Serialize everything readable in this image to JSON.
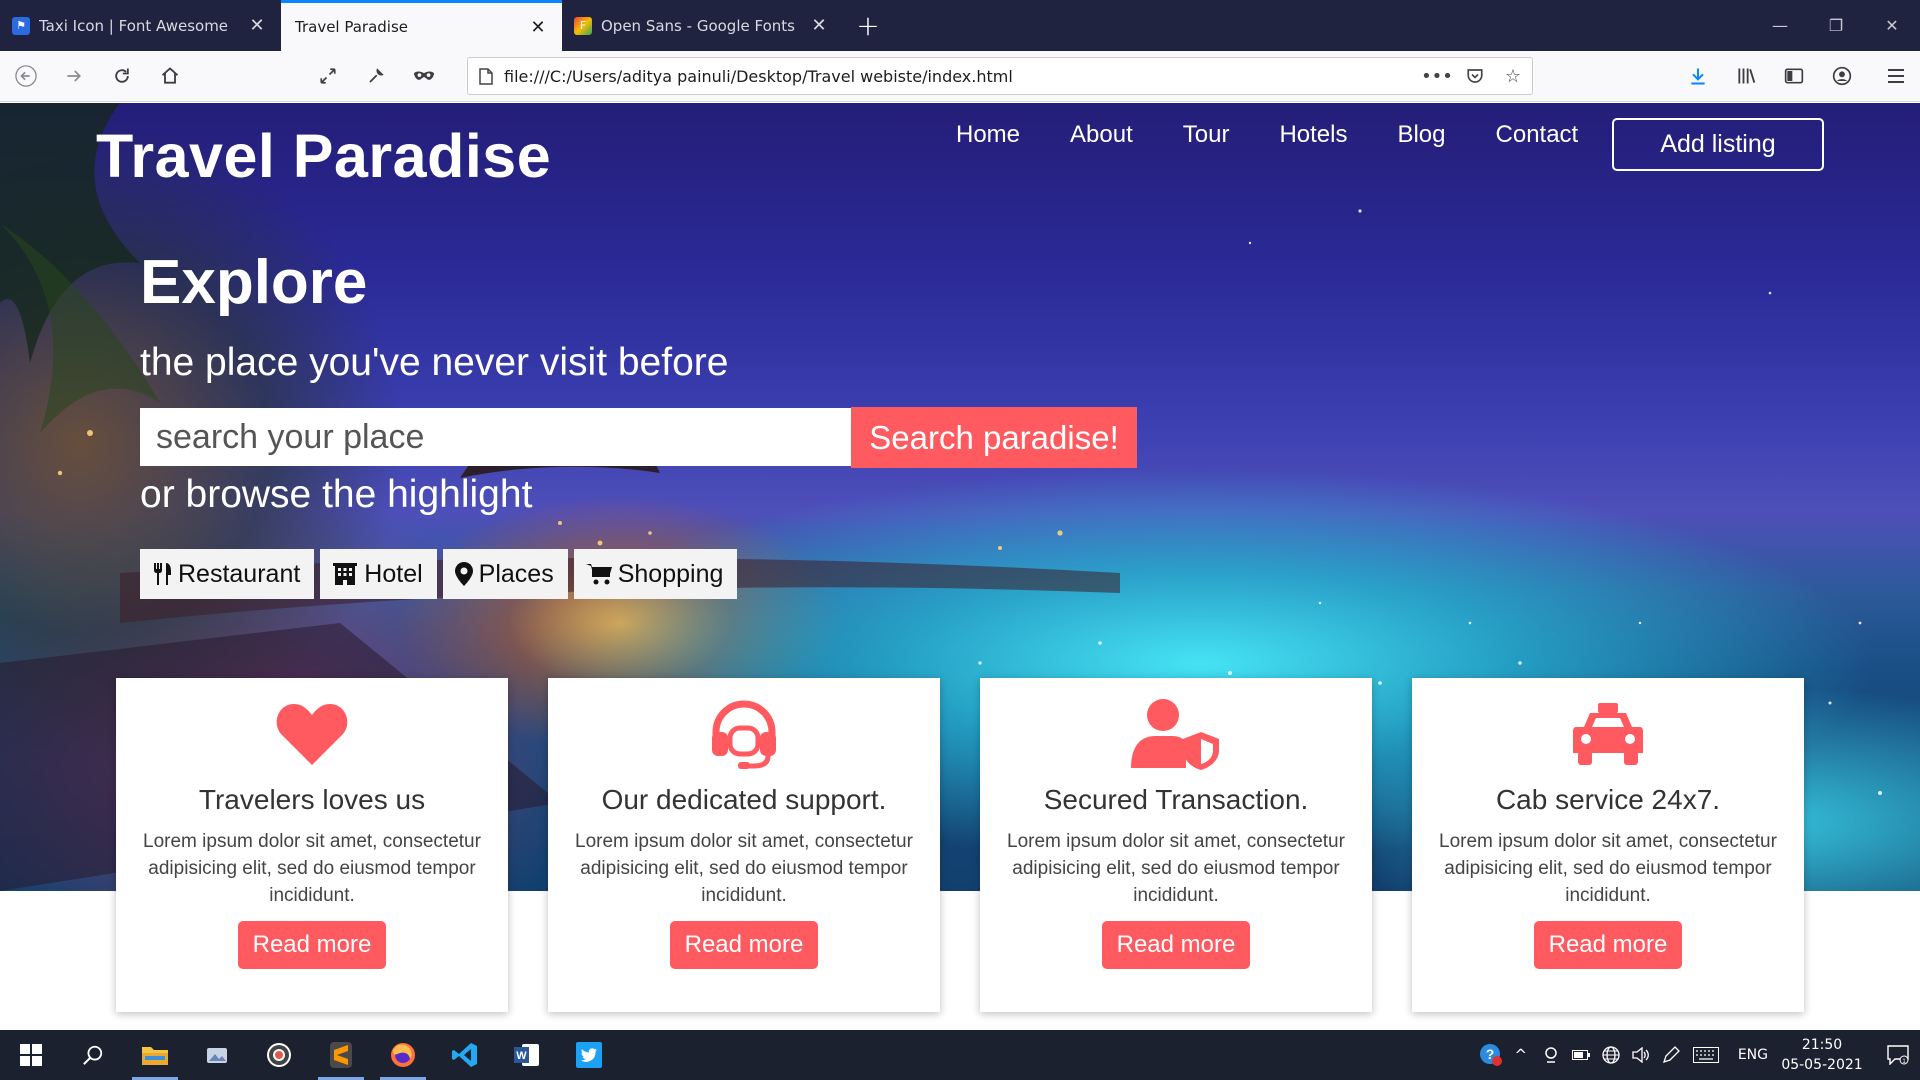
{
  "browser": {
    "tabs": [
      {
        "title": "Taxi Icon | Font Awesome",
        "active": false,
        "favicon_color": "#2a6be0"
      },
      {
        "title": "Travel Paradise",
        "active": true,
        "favicon_color": ""
      },
      {
        "title": "Open Sans - Google Fonts",
        "active": false,
        "favicon_color": "#ea4335"
      }
    ],
    "url": "file:///C:/Users/aditya painuli/Desktop/Travel webiste/index.html"
  },
  "page": {
    "brand": "Travel Paradise",
    "nav": [
      "Home",
      "About",
      "Tour",
      "Hotels",
      "Blog",
      "Contact"
    ],
    "add_listing": "Add listing",
    "hero": {
      "title": "Explore",
      "subtitle": "the place you've never visit before",
      "search_placeholder": "search your place",
      "search_button": "Search paradise!",
      "browse_text": "or browse the highlight"
    },
    "categories": [
      {
        "label": "Restaurant",
        "icon": "utensils-icon"
      },
      {
        "label": "Hotel",
        "icon": "hotel-icon"
      },
      {
        "label": "Places",
        "icon": "map-marker-icon"
      },
      {
        "label": "Shopping",
        "icon": "shopping-cart-icon"
      }
    ],
    "cards": [
      {
        "title": "Travelers loves us",
        "text": "Lorem ipsum dolor sit amet, consectetur adipisicing elit, sed do eiusmod tempor incididunt.",
        "button": "Read more",
        "icon": "heart-icon"
      },
      {
        "title": "Our dedicated support.",
        "text": "Lorem ipsum dolor sit amet, consectetur adipisicing elit, sed do eiusmod tempor incididunt.",
        "button": "Read more",
        "icon": "headset-icon"
      },
      {
        "title": "Secured Transaction.",
        "text": "Lorem ipsum dolor sit amet, consectetur adipisicing elit, sed do eiusmod tempor incididunt.",
        "button": "Read more",
        "icon": "user-shield-icon"
      },
      {
        "title": "Cab service 24x7.",
        "text": "Lorem ipsum dolor sit amet, consectetur adipisicing elit, sed do eiusmod tempor incididunt.",
        "button": "Read more",
        "icon": "taxi-icon"
      }
    ],
    "accent_color": "#ff5a5f"
  },
  "taskbar": {
    "apps": [
      "start-icon",
      "search-icon",
      "file-explorer-icon",
      "photos-icon",
      "chrome-icon",
      "sublime-text-icon",
      "firefox-icon",
      "vscode-icon",
      "word-icon",
      "twitter-icon"
    ],
    "language": "ENG",
    "time": "21:50",
    "date": "05-05-2021"
  }
}
